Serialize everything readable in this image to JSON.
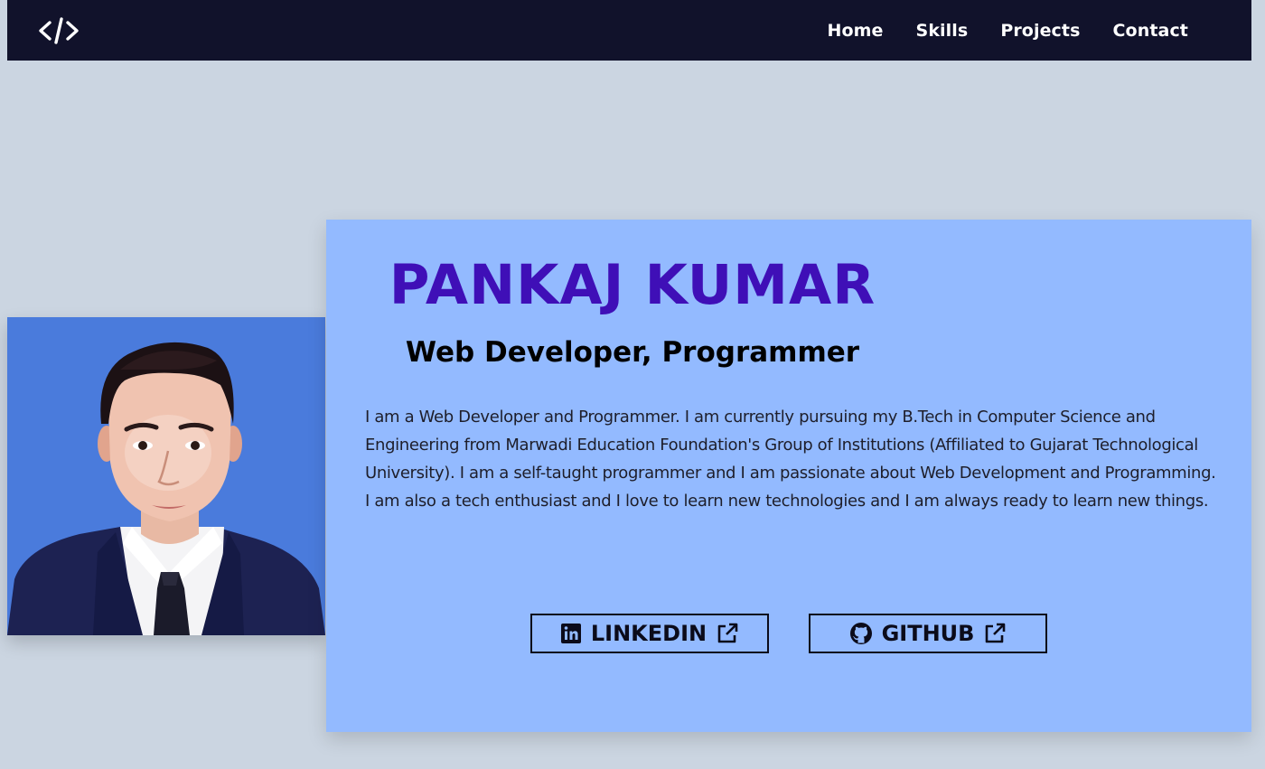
{
  "nav": {
    "logo_icon": "code-icon",
    "links": [
      "Home",
      "Skills",
      "Projects",
      "Contact"
    ]
  },
  "profile": {
    "photo_icon": "profile-photo",
    "name": "PANKAJ KUMAR",
    "role": "Web Developer, Programmer",
    "bio": "I am a Web Developer and Programmer. I am currently pursuing my B.Tech in Computer Science and Engineering from Marwadi Education Foundation's Group of Institutions (Affiliated to Gujarat Technological University). I am a self-taught programmer and I am passionate about Web Development and Programming. I am also a tech enthusiast and I love to learn new technologies and I am always ready to learn new things."
  },
  "social": {
    "linkedin_label": "LINKEDIN",
    "github_label": "GITHUB",
    "icons": [
      "linkedin-icon",
      "github-icon",
      "external-link-icon"
    ]
  },
  "colors": {
    "navbar": "#11122b",
    "background": "#cbd5e1",
    "card": "#93baff",
    "name": "#3f0fb7",
    "photo_bg": "#4a7bdc"
  }
}
